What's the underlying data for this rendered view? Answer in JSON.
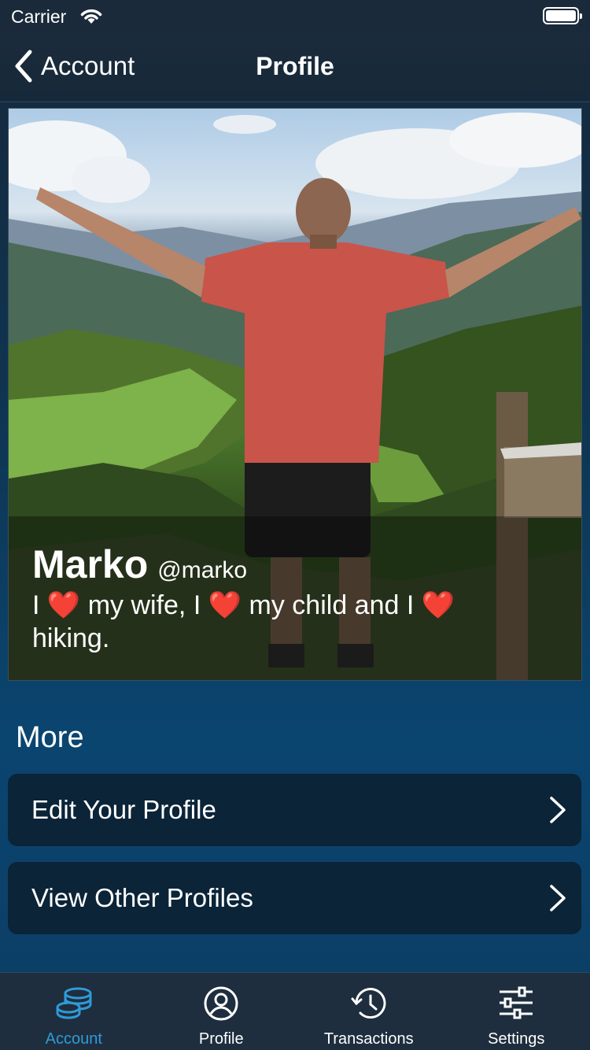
{
  "status_bar": {
    "carrier": "Carrier"
  },
  "nav": {
    "back_label": "Account",
    "title": "Profile"
  },
  "profile": {
    "name": "Marko",
    "handle": "@marko",
    "bio_parts": [
      "I",
      "my wife, I",
      "my child and I",
      "hiking."
    ],
    "heart_icon": "heart-emoji"
  },
  "more": {
    "title": "More",
    "items": [
      {
        "label": "Edit Your Profile"
      },
      {
        "label": "View Other Profiles"
      }
    ]
  },
  "tabs": [
    {
      "label": "Account",
      "icon": "coins-icon",
      "active": true
    },
    {
      "label": "Profile",
      "icon": "person-circle-icon",
      "active": false
    },
    {
      "label": "Transactions",
      "icon": "history-icon",
      "active": false
    },
    {
      "label": "Settings",
      "icon": "sliders-icon",
      "active": false
    }
  ],
  "colors": {
    "accent": "#2f9bd8",
    "heart": "#e8231f"
  }
}
